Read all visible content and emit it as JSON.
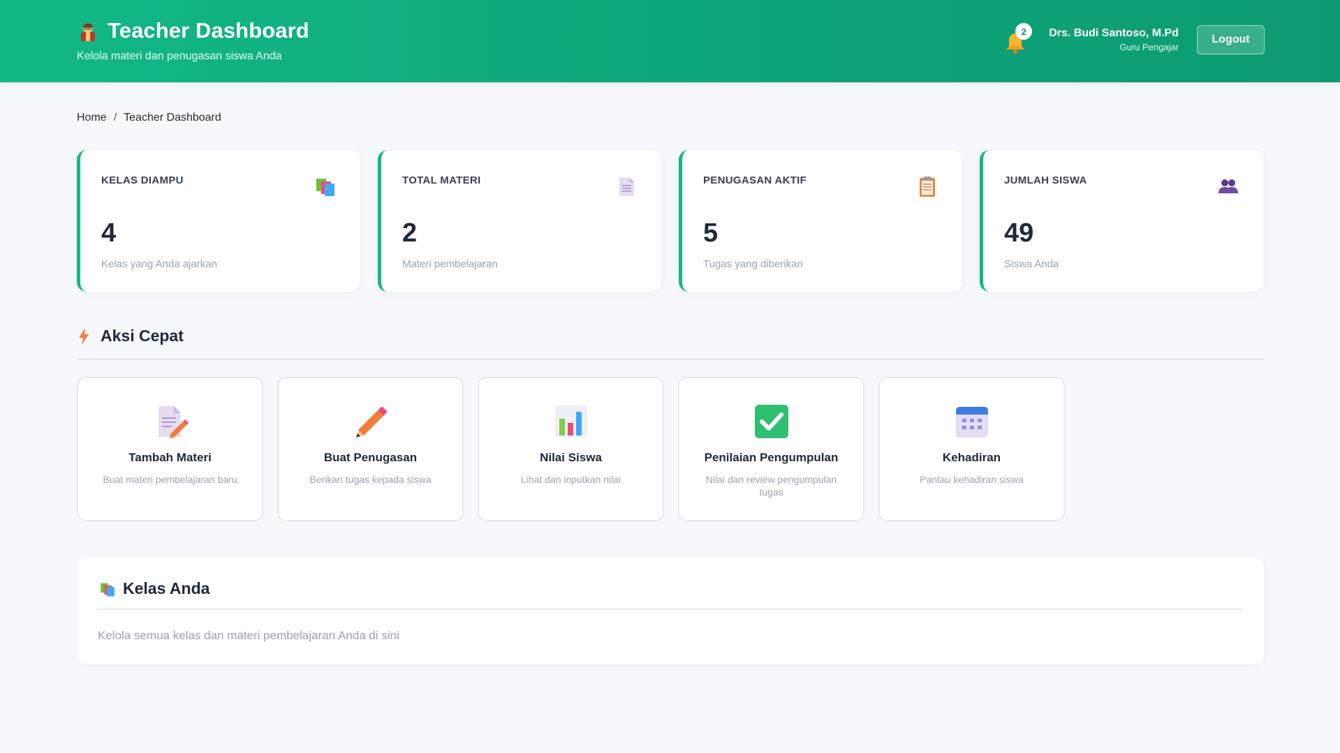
{
  "header": {
    "title": "Teacher Dashboard",
    "subtitle": "Kelola materi dan penugasan siswa Anda",
    "notification_count": "2",
    "user_name": "Drs. Budi Santoso, M.Pd",
    "user_role": "Guru Pengajar",
    "logout_label": "Logout",
    "accent_color": "#12b886"
  },
  "breadcrumb": {
    "home": "Home",
    "separator": "/",
    "current": "Teacher Dashboard"
  },
  "stats": [
    {
      "label": "KELAS DIAMPU",
      "value": "4",
      "desc": "Kelas yang Anda ajarkan",
      "icon": "books-icon"
    },
    {
      "label": "TOTAL MATERI",
      "value": "2",
      "desc": "Materi pembelajaran",
      "icon": "document-icon"
    },
    {
      "label": "PENUGASAN AKTIF",
      "value": "5",
      "desc": "Tugas yang diberikan",
      "icon": "clipboard-icon"
    },
    {
      "label": "JUMLAH SISWA",
      "value": "49",
      "desc": "Siswa Anda",
      "icon": "users-icon"
    }
  ],
  "quick_actions": {
    "title": "Aksi Cepat",
    "items": [
      {
        "title": "Tambah Materi",
        "desc": "Buat materi pembelajaran baru",
        "icon": "document-edit-icon"
      },
      {
        "title": "Buat Penugasan",
        "desc": "Berikan tugas kepada siswa",
        "icon": "pencil-icon"
      },
      {
        "title": "Nilai Siswa",
        "desc": "Lihat dan inputkan nilai",
        "icon": "bar-chart-icon"
      },
      {
        "title": "Penilaian Pengumpulan",
        "desc": "Nilai dan review pengumpulan tugas",
        "icon": "check-box-icon"
      },
      {
        "title": "Kehadiran",
        "desc": "Pantau kehadiran siswa",
        "icon": "calendar-icon"
      }
    ]
  },
  "kelas": {
    "title": "Kelas Anda",
    "desc": "Kelola semua kelas dan materi pembelajaran Anda di sini"
  }
}
